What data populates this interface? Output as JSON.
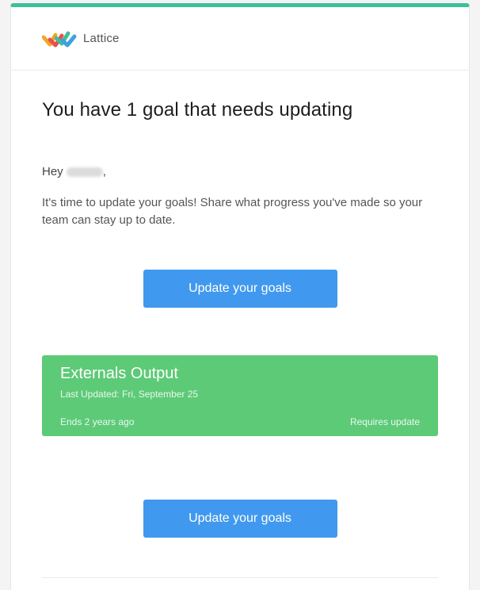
{
  "brand": {
    "name": "Lattice",
    "accent": "#3dbf9a"
  },
  "email": {
    "heading": "You have 1 goal that needs updating",
    "greeting": "Hey",
    "greeting_suffix": ",",
    "message": "It's time to update your goals! Share what progress you've made so your team can stay up to date.",
    "cta_primary": "Update your goals",
    "cta_secondary": "Update your goals"
  },
  "goal": {
    "title": "Externals Output",
    "last_updated": "Last Updated: Fri, September 25",
    "ends": "Ends 2 years ago",
    "status": "Requires update",
    "color": "#5dca77"
  },
  "colors": {
    "button": "#4099ee"
  }
}
